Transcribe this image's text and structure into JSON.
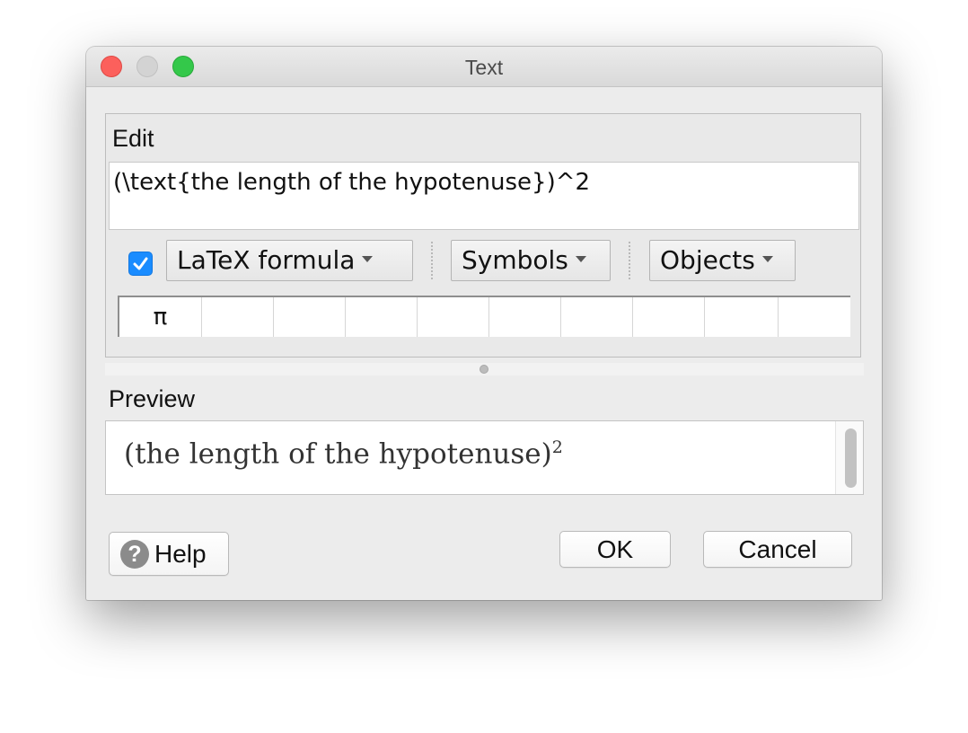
{
  "window": {
    "title": "Text"
  },
  "edit": {
    "label": "Edit",
    "input_value": "(\\text{the length of the hypotenuse})^2",
    "latex_checked": true,
    "latex_label": "LaTeX formula",
    "symbols_label": "Symbols",
    "objects_label": "Objects",
    "symbols": [
      "π",
      "",
      "",
      "",
      "",
      "",
      "",
      "",
      "",
      ""
    ]
  },
  "preview": {
    "label": "Preview",
    "text": "(the length of the hypotenuse)",
    "exponent": "2"
  },
  "buttons": {
    "help": "Help",
    "ok": "OK",
    "cancel": "Cancel"
  },
  "colors": {
    "checkbox": "#1a8cff",
    "close": "#fc605c",
    "maximize": "#34c84a"
  }
}
